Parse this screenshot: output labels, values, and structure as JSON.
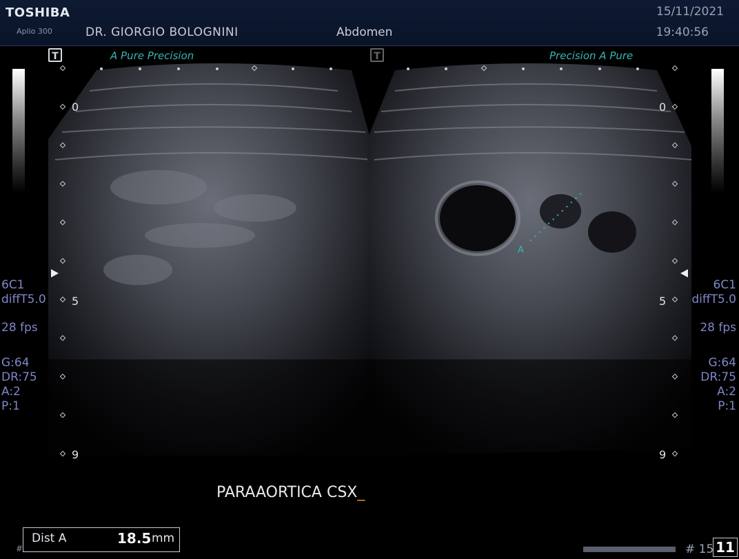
{
  "header": {
    "brand": "TOSHIBA",
    "model": "Aplio 300",
    "doctor": "DR. GIORGIO BOLOGNINI",
    "exam": "Abdomen",
    "date": "15/11/2021",
    "time": "19:40:56"
  },
  "left_view": {
    "mode_label": "A Pure Precision",
    "depth_labels": [
      "0",
      "5",
      "9"
    ],
    "params": {
      "probe": "6C1",
      "filter": "diffT5.0",
      "fps": "28 fps",
      "gain": "G:64",
      "dr": "DR:75",
      "a": "A:2",
      "p": "P:1"
    }
  },
  "right_view": {
    "mode_label": "Precision  A Pure",
    "depth_labels": [
      "0",
      "5",
      "9"
    ],
    "params": {
      "probe": "6C1",
      "filter": "diffT5.0",
      "fps": "28 fps",
      "gain": "G:64",
      "dr": "DR:75",
      "a": "A:2",
      "p": "P:1"
    },
    "measurement_marker": "A"
  },
  "annotation": {
    "text": "PARAAORTICA CSX",
    "cursor": "_"
  },
  "measurement": {
    "label": "Dist A",
    "value": "18.5",
    "unit": "mm"
  },
  "footer": {
    "frame_prefix": "# 15",
    "frame_current": "11",
    "hash": "#"
  },
  "icons": {
    "tmark": "T"
  },
  "colors": {
    "accent": "#3ab4b4",
    "params": "#7f86c8",
    "cursor": "#e08a2a"
  }
}
